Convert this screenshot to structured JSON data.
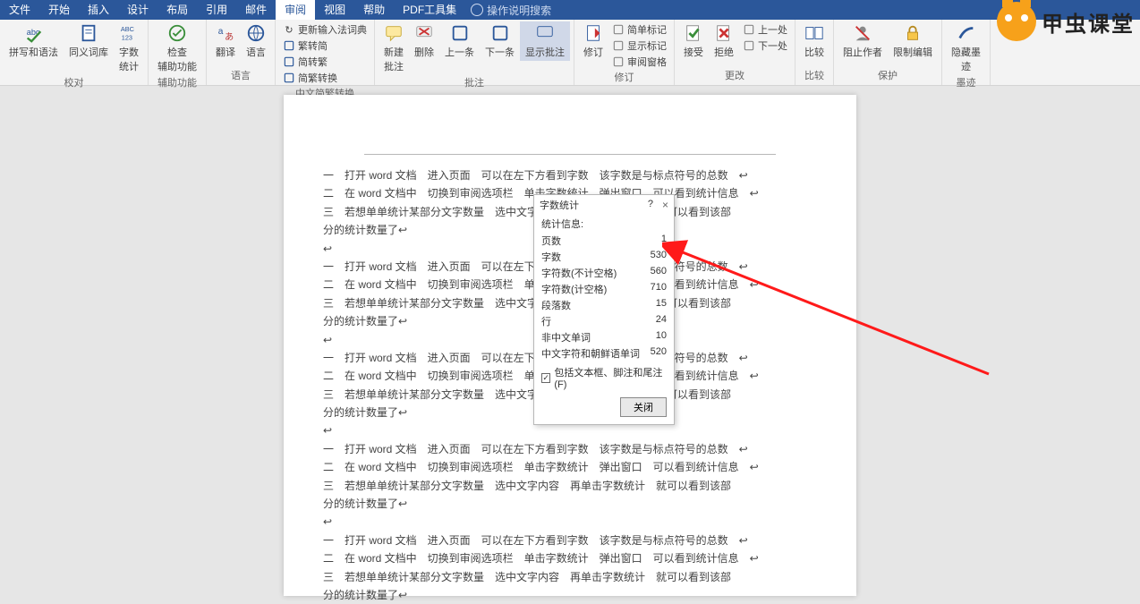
{
  "menu": {
    "items": [
      "文件",
      "开始",
      "插入",
      "设计",
      "布局",
      "引用",
      "邮件",
      "审阅",
      "视图",
      "帮助",
      "PDF工具集"
    ],
    "active_index": 7,
    "search_hint": "操作说明搜索"
  },
  "ribbon": {
    "groups": [
      {
        "label": "校对",
        "buttons": [
          {
            "name": "spell-grammar",
            "text": "拼写和语法"
          },
          {
            "name": "thesaurus",
            "text": "同义词库"
          },
          {
            "name": "word-count",
            "text": "字数\n统计"
          }
        ]
      },
      {
        "label": "辅助功能",
        "buttons": [
          {
            "name": "check-accessibility",
            "text": "检查\n辅助功能"
          }
        ]
      },
      {
        "label": "语言",
        "buttons": [
          {
            "name": "translate",
            "text": "翻译"
          },
          {
            "name": "language",
            "text": "语言"
          }
        ]
      },
      {
        "label": "中文简繁转换",
        "extra": "更新输入法词典",
        "buttons": [
          {
            "name": "to-trad",
            "text": "繁转简"
          },
          {
            "name": "to-simp",
            "text": "简转繁"
          },
          {
            "name": "sc-tc",
            "text": "简繁转换"
          }
        ]
      },
      {
        "label": "批注",
        "buttons": [
          {
            "name": "new-comment",
            "text": "新建\n批注"
          },
          {
            "name": "delete-comment",
            "text": "删除"
          },
          {
            "name": "prev-comment",
            "text": "上一条"
          },
          {
            "name": "next-comment",
            "text": "下一条"
          },
          {
            "name": "show-comments",
            "text": "显示批注",
            "highlight": true
          }
        ]
      },
      {
        "label": "修订",
        "buttons": [
          {
            "name": "track-changes",
            "text": "修订"
          }
        ],
        "side": [
          {
            "name": "simple-markup",
            "text": "简单标记"
          },
          {
            "name": "show-markup",
            "text": "显示标记"
          },
          {
            "name": "review-pane",
            "text": "审阅窗格"
          }
        ]
      },
      {
        "label": "更改",
        "buttons": [
          {
            "name": "accept",
            "text": "接受"
          },
          {
            "name": "reject",
            "text": "拒绝"
          }
        ],
        "side": [
          {
            "name": "prev-change",
            "text": "上一处"
          },
          {
            "name": "next-change",
            "text": "下一处"
          }
        ]
      },
      {
        "label": "比较",
        "buttons": [
          {
            "name": "compare",
            "text": "比较"
          }
        ]
      },
      {
        "label": "保护",
        "buttons": [
          {
            "name": "block-authors",
            "text": "阻止作者"
          },
          {
            "name": "restrict-edit",
            "text": "限制编辑"
          }
        ]
      },
      {
        "label": "墨迹",
        "buttons": [
          {
            "name": "hide-ink",
            "text": "隐藏墨\n迹"
          }
        ]
      }
    ]
  },
  "document": {
    "lines": [
      "一　打开 word 文档　进入页面　可以在左下方看到字数　该字数是与标点符号的总数　↩",
      "二　在 word 文档中　切换到审阅选项栏　单击字数统计　弹出窗口　可以看到统计信息　↩",
      "三　若想单单统计某部分文字数量　选中文字内容　再单击字数统计　就可以看到该部",
      "分的统计数量了↩",
      "↩",
      "一　打开 word 文档　进入页面　可以在左下方看到字数　该字数是与标点符号的总数　↩",
      "二　在 word 文档中　切换到审阅选项栏　单击字数统计　弹出窗口　可以看到统计信息　↩",
      "三　若想单单统计某部分文字数量　选中文字内容　再单击字数统计　就可以看到该部",
      "分的统计数量了↩",
      "↩",
      "一　打开 word 文档　进入页面　可以在左下方看到字数　该字数是与标点符号的总数　↩",
      "二　在 word 文档中　切换到审阅选项栏　单击字数统计　弹出窗口　可以看到统计信息　↩",
      "三　若想单单统计某部分文字数量　选中文字内容　再单击字数统计　就可以看到该部",
      "分的统计数量了↩",
      "↩",
      "一　打开 word 文档　进入页面　可以在左下方看到字数　该字数是与标点符号的总数　↩",
      "二　在 word 文档中　切换到审阅选项栏　单击字数统计　弹出窗口　可以看到统计信息　↩",
      "三　若想单单统计某部分文字数量　选中文字内容　再单击字数统计　就可以看到该部",
      "分的统计数量了↩",
      "↩",
      "一　打开 word 文档　进入页面　可以在左下方看到字数　该字数是与标点符号的总数　↩",
      "二　在 word 文档中　切换到审阅选项栏　单击字数统计　弹出窗口　可以看到统计信息　↩",
      "三　若想单单统计某部分文字数量　选中文字内容　再单击字数统计　就可以看到该部",
      "分的统计数量了↩"
    ]
  },
  "dialog": {
    "title": "字数统计",
    "help": "?",
    "close_x": "×",
    "info_label": "统计信息:",
    "rows": [
      {
        "k": "页数",
        "v": "1"
      },
      {
        "k": "字数",
        "v": "530"
      },
      {
        "k": "字符数(不计空格)",
        "v": "560"
      },
      {
        "k": "字符数(计空格)",
        "v": "710"
      },
      {
        "k": "段落数",
        "v": "15"
      },
      {
        "k": "行",
        "v": "24"
      },
      {
        "k": "非中文单词",
        "v": "10"
      },
      {
        "k": "中文字符和朝鲜语单词",
        "v": "520"
      }
    ],
    "checkbox": "包括文本框、脚注和尾注(F)",
    "check_mark": "✓",
    "close_btn": "关闭"
  },
  "logo_text": "甲虫课堂"
}
